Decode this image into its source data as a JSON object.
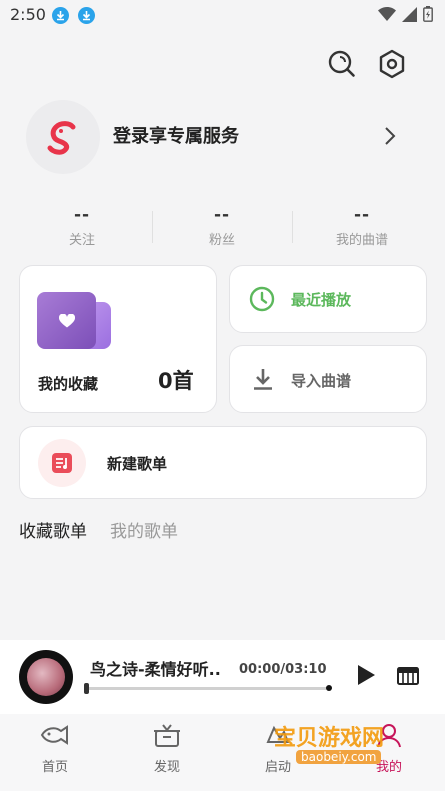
{
  "status_bar": {
    "time": "2:50"
  },
  "profile": {
    "login_text": "登录享专属服务"
  },
  "stats": [
    {
      "value": "--",
      "label": "关注"
    },
    {
      "value": "--",
      "label": "粉丝"
    },
    {
      "value": "--",
      "label": "我的曲谱"
    }
  ],
  "favorites": {
    "label": "我的收藏",
    "count": "0首"
  },
  "recent": {
    "label": "最近播放"
  },
  "import": {
    "label": "导入曲谱"
  },
  "new_playlist": {
    "label": "新建歌单"
  },
  "playlist_tabs": {
    "active": "收藏歌单",
    "inactive": "我的歌单"
  },
  "player": {
    "title": "鸟之诗-柔情好听..",
    "time": "00:00/03:10",
    "progress": 0
  },
  "bottom_nav": [
    {
      "label": "首页"
    },
    {
      "label": "发现"
    },
    {
      "label": "启动"
    },
    {
      "label": "我的"
    }
  ],
  "watermark": {
    "text": "宝贝游戏网",
    "url": "baobeiy.com"
  },
  "colors": {
    "accent": "#c7155a",
    "recent_green": "#5cb85c",
    "download_blue": "#2aa3ea"
  }
}
